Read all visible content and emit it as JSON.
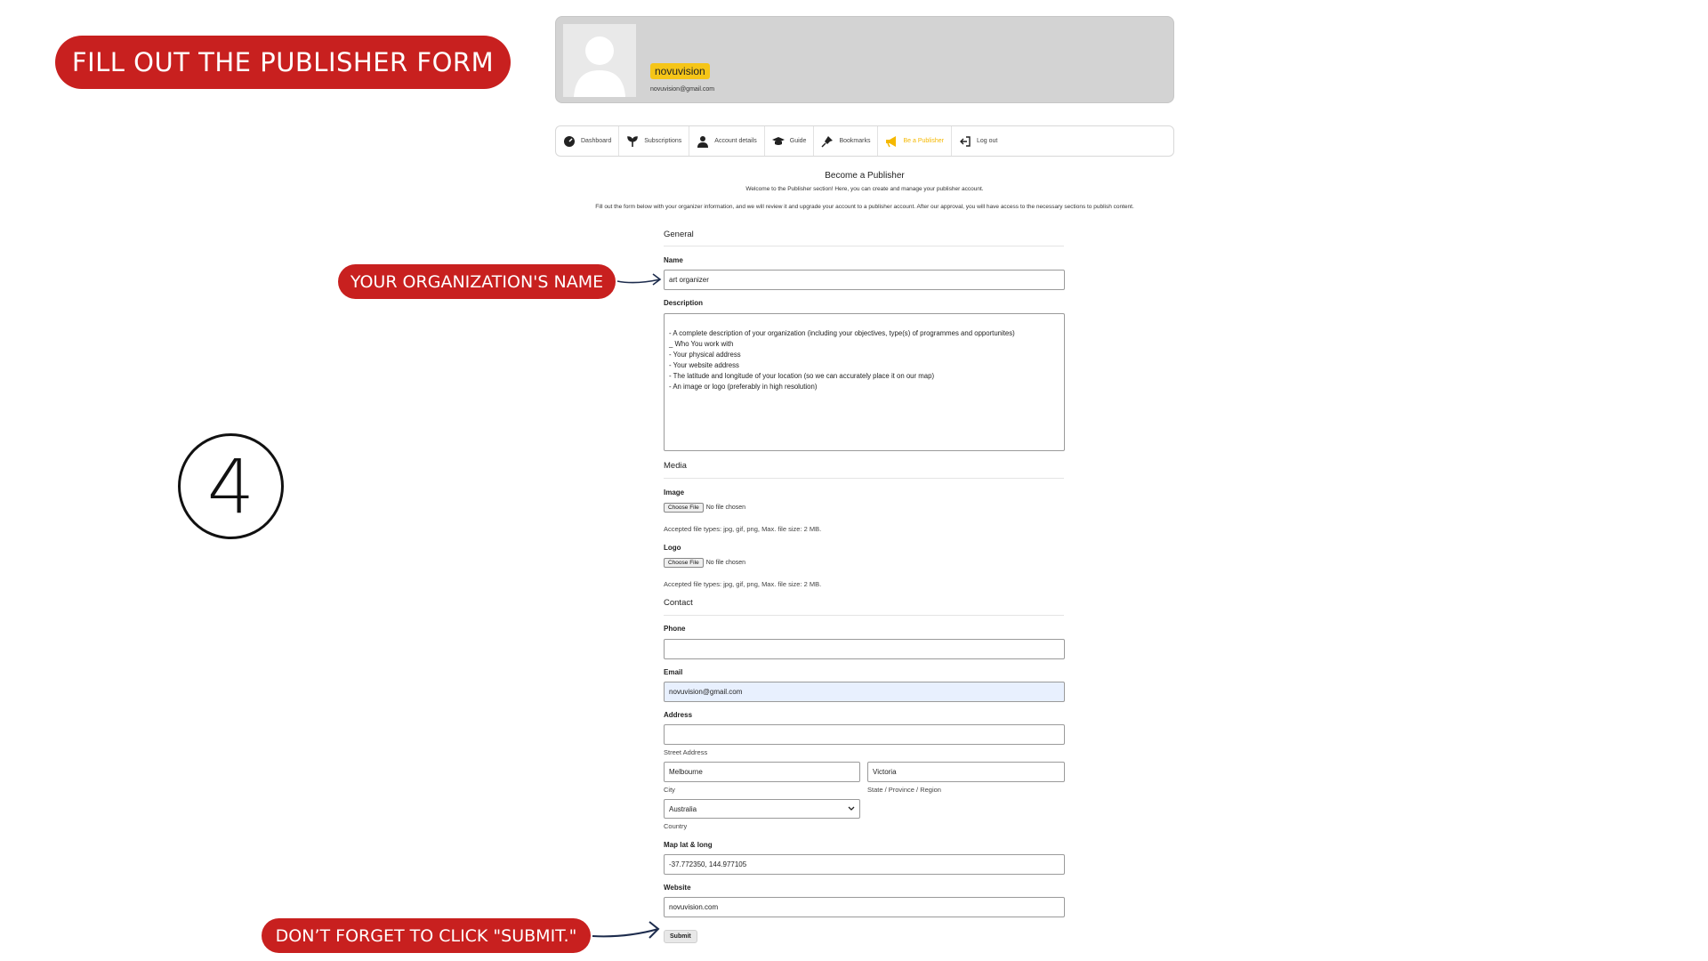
{
  "annotations": {
    "title": "FILL OUT THE PUBLISHER FORM",
    "name_hint": "YOUR ORGANIZATION'S NAME",
    "submit_hint": "DON’T FORGET TO CLICK \"SUBMIT.\"",
    "step_number": "4",
    "pill_color": "#c8201f"
  },
  "profile": {
    "username": "novuvision",
    "email": "novuvision@gmail.com",
    "badge_color": "#f5c518",
    "avatar_icon": "user-silhouette-icon"
  },
  "nav": {
    "items": [
      {
        "label": "Dashboard",
        "icon": "gauge-icon"
      },
      {
        "label": "Subscriptions",
        "icon": "subscriptions-icon"
      },
      {
        "label": "Account details",
        "icon": "user-icon"
      },
      {
        "label": "Guide",
        "icon": "graduation-cap-icon"
      },
      {
        "label": "Bookmarks",
        "icon": "pin-icon"
      },
      {
        "label": "Be a Publisher",
        "icon": "megaphone-icon",
        "active": true
      },
      {
        "label": "Log out",
        "icon": "logout-icon"
      }
    ],
    "active_color": "#f5b800"
  },
  "intro": {
    "heading": "Become a Publisher",
    "line1": "Welcome to the Publisher section! Here, you can create and manage your publisher account.",
    "line2": "Fill out the form below with your organizer information, and we will review it and upgrade your account to a publisher account. After our approval, you will have access to the necessary sections to publish content."
  },
  "form": {
    "general": {
      "title": "General",
      "name_label": "Name",
      "name_value": "art organizer",
      "description_label": "Description",
      "description_value": "- A complete description of your organization (including your objectives, type(s) of programmes and opportunites)\n_ Who You work with\n- Your physical address\n- Your website address\n- The latitude and longitude of your location (so we can accurately place it on our map)\n- An image or logo (preferably in high resolution)"
    },
    "media": {
      "title": "Media",
      "image_label": "Image",
      "logo_label": "Logo",
      "choose_file": "Choose File",
      "no_file": "No file chosen",
      "accepted": "Accepted file types: jpg, gif, png, Max. file size: 2 MB."
    },
    "contact": {
      "title": "Contact",
      "phone_label": "Phone",
      "phone_value": "",
      "email_label": "Email",
      "email_value": "novuvision@gmail.com",
      "address_label": "Address",
      "street_value": "",
      "street_caption": "Street Address",
      "city_value": "Melbourne",
      "city_caption": "City",
      "state_value": "Victoria",
      "state_caption": "State / Province / Region",
      "country_value": "Australia",
      "country_caption": "Country",
      "maplatlong_label": "Map lat & long",
      "maplatlong_value": "-37.772350, 144.977105",
      "website_label": "Website",
      "website_value": "novuvision.com"
    },
    "submit_label": "Submit"
  }
}
